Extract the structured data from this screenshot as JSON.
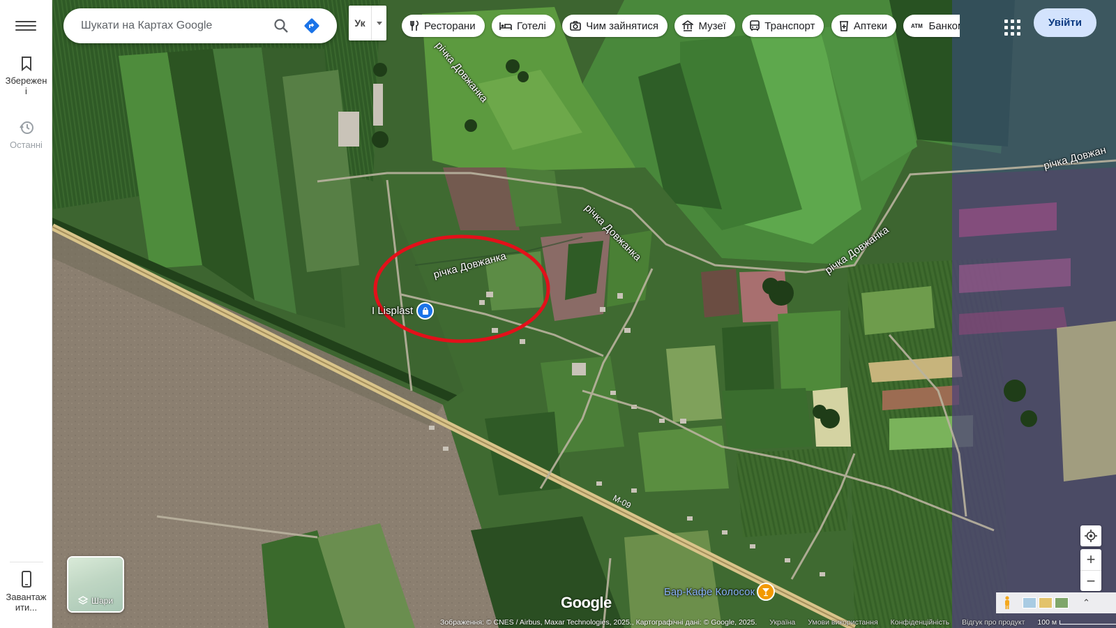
{
  "search": {
    "placeholder": "Шукати на Картах Google"
  },
  "language": {
    "value": "Ук"
  },
  "rail": {
    "saved_label": "Збережен\nі",
    "recent_label": "Останні",
    "download_label": "Завантаж\nити..."
  },
  "chips": [
    {
      "label": "Ресторани",
      "icon": "fork-knife-icon"
    },
    {
      "label": "Готелі",
      "icon": "bed-icon"
    },
    {
      "label": "Чим зайнятися",
      "icon": "camera-icon"
    },
    {
      "label": "Музеї",
      "icon": "museum-icon"
    },
    {
      "label": "Транспорт",
      "icon": "bus-icon"
    },
    {
      "label": "Аптеки",
      "icon": "pharmacy-icon"
    },
    {
      "label": "Банкомати",
      "icon": "atm-icon"
    }
  ],
  "signin": {
    "label": "Увійти"
  },
  "map_labels": {
    "river_1": "річка Довжанка",
    "river_2": "річка Довжанка",
    "river_3": "річка Довжанка",
    "river_4": "річка Довжанка",
    "river_5": "річка Довжан",
    "poi_name": "I Lisplast",
    "bar_name": "Бар-Кафе Колосок",
    "road_code": "М-09"
  },
  "layers": {
    "label": "Шари"
  },
  "brand": {
    "wordmark": "Google"
  },
  "footer": {
    "attribution": "Зображення: © CNES / Airbus, Maxar Technologies, 2025., Картографічні дані: © Google, 2025.",
    "country": "Україна",
    "terms": "Умови використання",
    "privacy": "Конфіденційність",
    "feedback": "Відгук про продукт",
    "scale": "100 м"
  },
  "colors": {
    "poi_pin": "#1a73e8",
    "bar_pin": "#f29900",
    "annotation_circle": "#e3101a",
    "signin_bg": "#d3e3fd"
  }
}
